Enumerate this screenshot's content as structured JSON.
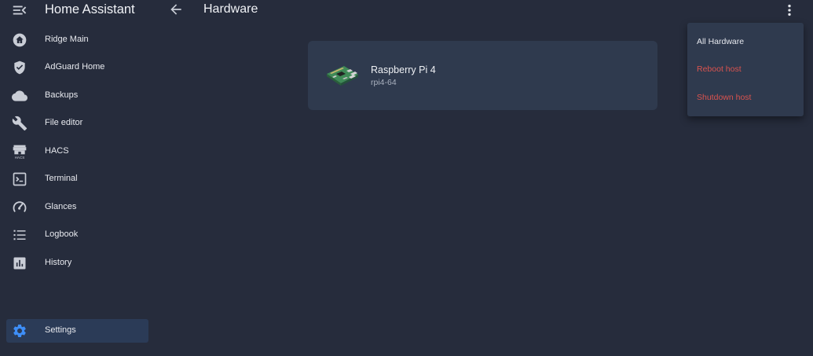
{
  "app": {
    "title": "Home Assistant"
  },
  "header": {
    "title": "Hardware"
  },
  "sidebar": {
    "items": [
      {
        "label": "Ridge Main",
        "icon": "home-icon"
      },
      {
        "label": "AdGuard Home",
        "icon": "shield-check-icon"
      },
      {
        "label": "Backups",
        "icon": "cloud-icon"
      },
      {
        "label": "File editor",
        "icon": "wrench-icon"
      },
      {
        "label": "HACS",
        "icon": "hacs-store-icon"
      },
      {
        "label": "Terminal",
        "icon": "console-icon"
      },
      {
        "label": "Glances",
        "icon": "gauge-icon"
      },
      {
        "label": "Logbook",
        "icon": "format-list-icon"
      },
      {
        "label": "History",
        "icon": "chart-box-icon"
      }
    ],
    "settings": {
      "label": "Settings",
      "icon": "cog-icon"
    },
    "hacs_icon_text": "HACS"
  },
  "card": {
    "title": "Raspberry Pi 4",
    "subtitle": "rpi4-64",
    "image": "raspberry-pi-board-icon"
  },
  "menu": {
    "items": [
      {
        "label": "All Hardware",
        "color": "#e6e8ee"
      },
      {
        "label": "Reboot host",
        "color": "#d9534f"
      },
      {
        "label": "Shutdown host",
        "color": "#d9534f"
      }
    ]
  },
  "colors": {
    "background": "#262c3c",
    "card": "#2f3a4e",
    "active_item": "#2b3b57",
    "accent": "#3e8ef7",
    "danger": "#d9534f"
  }
}
